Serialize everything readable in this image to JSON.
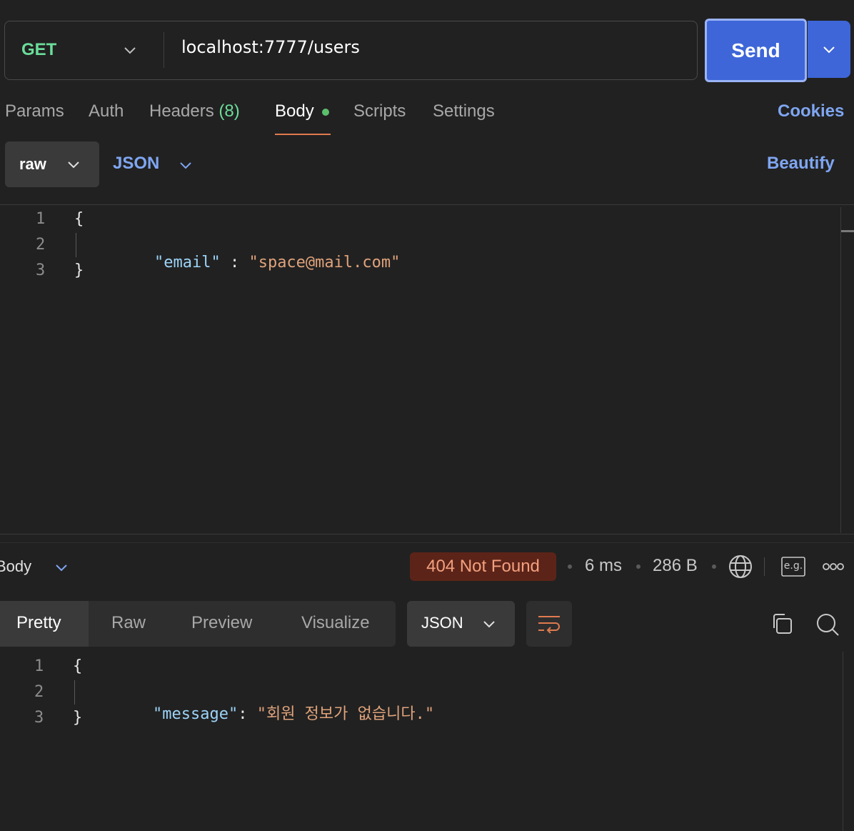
{
  "request": {
    "method": "GET",
    "url": "localhost:7777/users",
    "send_label": "Send",
    "tabs": [
      {
        "label": "Params"
      },
      {
        "label": "Auth"
      },
      {
        "label": "Headers",
        "count": "(8)"
      },
      {
        "label": "Body"
      },
      {
        "label": "Scripts"
      },
      {
        "label": "Settings"
      }
    ],
    "active_tab": "Body",
    "cookies_label": "Cookies",
    "body_mode": "raw",
    "body_format": "JSON",
    "beautify_label": "Beautify",
    "body_lines": [
      {
        "num": "1",
        "text": "{"
      },
      {
        "num": "2",
        "key": "\"email\"",
        "sep": " : ",
        "value": "\"space@mail.com\""
      },
      {
        "num": "3",
        "text": "}"
      }
    ]
  },
  "response": {
    "view_label": "Body",
    "status": "404 Not Found",
    "time": "6 ms",
    "size": "286 B",
    "example_label": "e.g.",
    "tabs": [
      {
        "label": "Pretty"
      },
      {
        "label": "Raw"
      },
      {
        "label": "Preview"
      },
      {
        "label": "Visualize"
      }
    ],
    "active_tab": "Pretty",
    "format": "JSON",
    "body_lines": [
      {
        "num": "1",
        "text": "{"
      },
      {
        "num": "2",
        "key": "\"message\"",
        "sep": ": ",
        "value": "\"회원 정보가 없습니다.\""
      },
      {
        "num": "3",
        "text": "}"
      }
    ]
  },
  "colors": {
    "background": "#212121",
    "accent": "#3e66d8",
    "method_get": "#6bdd9a",
    "link": "#7fa6f2",
    "status_error_bg": "#5c2418",
    "status_error_text": "#f3a07f",
    "json_key": "#9cd4f8",
    "json_string": "#e0a37b"
  }
}
